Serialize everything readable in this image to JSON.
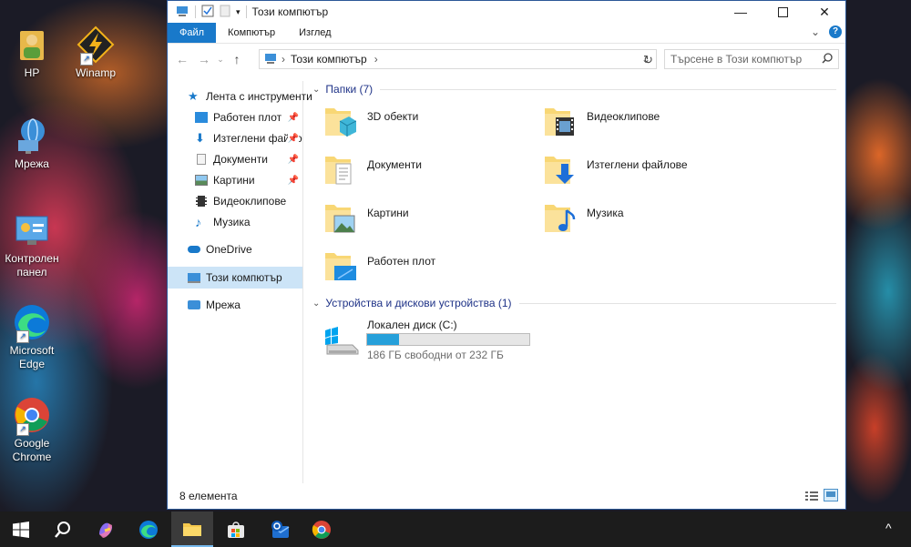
{
  "desktop": {
    "icons": [
      {
        "label": "HP"
      },
      {
        "label": "Winamp"
      },
      {
        "label": "Мрежа"
      },
      {
        "label": "Контролен панел"
      },
      {
        "label": "Microsoft Edge"
      },
      {
        "label": "Google Chrome"
      }
    ]
  },
  "window": {
    "title": "Този компютър",
    "ribbon_tabs": [
      "Файл",
      "Компютър",
      "Изглед"
    ],
    "address_path": "Този компютър",
    "search_placeholder": "Търсене в Този компютър",
    "sidebar": {
      "quick_access": "Лента с инструменти",
      "quick_items": [
        "Работен плот",
        "Изтеглени файлове",
        "Документи",
        "Картини",
        "Видеоклипове",
        "Музика"
      ],
      "onedrive": "OneDrive",
      "this_pc": "Този компютър",
      "network": "Мрежа"
    },
    "folders_group": "Папки (7)",
    "folders": [
      "3D обекти",
      "Видеоклипове",
      "Документи",
      "Изтеглени файлове",
      "Картини",
      "Музика",
      "Работен плот"
    ],
    "devices_group": "Устройства и дискови устройства (1)",
    "drive": {
      "name": "Локален диск (C:)",
      "free_text": "186 ГБ свободни от 232 ГБ",
      "used_fraction": 0.198
    },
    "status": "8 елемента"
  },
  "colors": {
    "accent": "#1979ca",
    "drive_bar": "#26a0da",
    "window_border": "#2b5797"
  }
}
